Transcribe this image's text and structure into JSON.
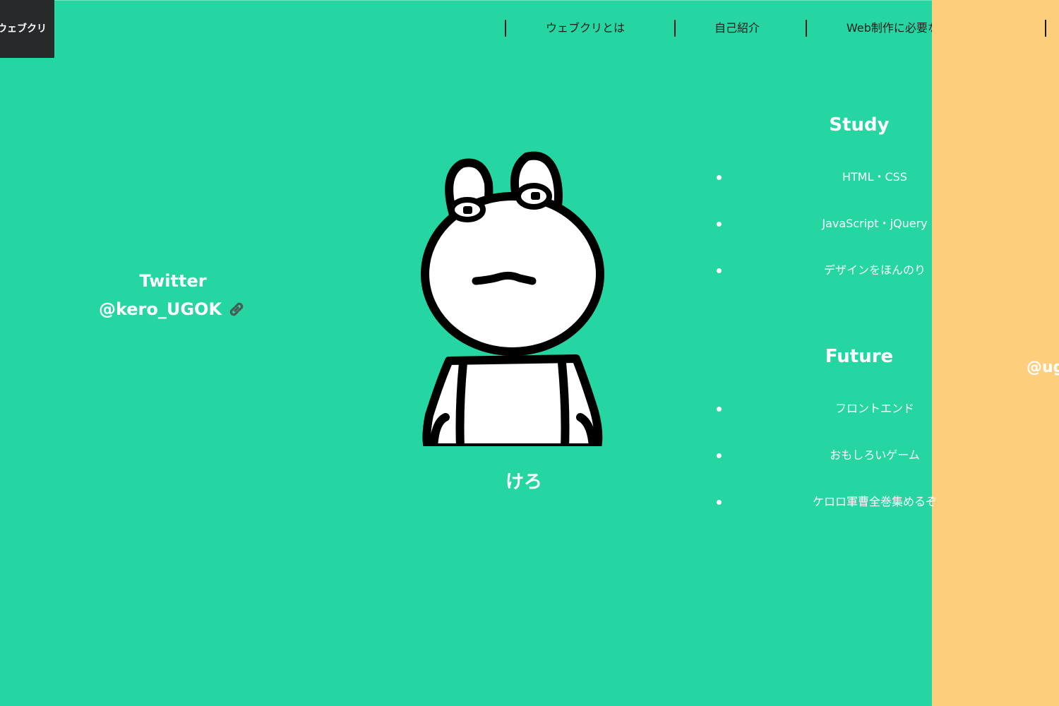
{
  "header": {
    "logo_text": "ウェブクリ",
    "nav": [
      {
        "label": "ウェブクリとは"
      },
      {
        "label": "自己紹介"
      },
      {
        "label": "Web制作に必要なモノ・コト"
      }
    ]
  },
  "profile": {
    "twitter_label": "Twitter",
    "twitter_handle": "@kero_UGOK",
    "name": "けろ",
    "link_icon": "link-icon",
    "avatar": "frog-illustration"
  },
  "study": {
    "title": "Study",
    "items": [
      "HTML・CSS",
      "JavaScript・jQuery",
      "デザインをほんのり"
    ]
  },
  "future": {
    "title": "Future",
    "items": [
      "フロントエンド",
      "おもしろいゲーム",
      "ケロロ軍曹全巻集めるぞ"
    ]
  },
  "next_panel": {
    "handle_partial": "@ug"
  },
  "colors": {
    "background": "#25d5a2",
    "logo_bg": "#27292b",
    "panel_orange": "#fdcf7c",
    "text_dark": "#1c1c1c",
    "text_light": "#ffffff"
  }
}
